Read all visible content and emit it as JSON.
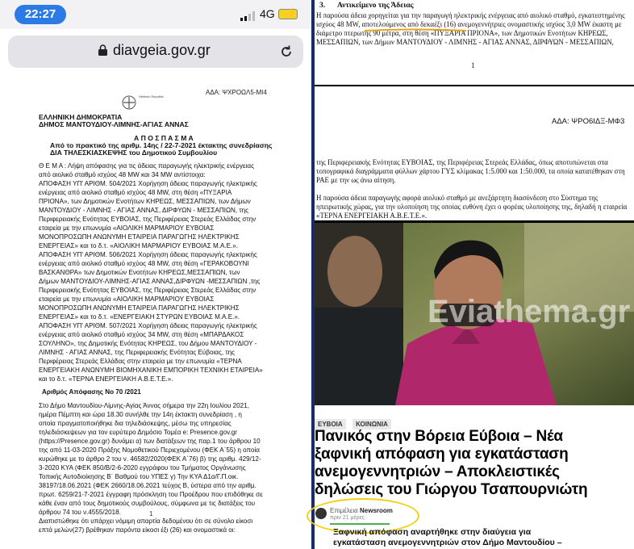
{
  "phone": {
    "status": {
      "time": "22:27",
      "network": "4G"
    },
    "browser": {
      "url": "diavgeia.gov.gr"
    },
    "document": {
      "ada": "ΑΔΑ: ΨΧΡΟΩΛ5-ΜΙ4",
      "logo_text": "Hellenic Republic",
      "lines": [
        {
          "t": "ΕΛΛΗΝΙΚΗ ΔΗΜΟΚΡΑΤΙΑ",
          "c": "bold"
        },
        {
          "t": "ΔΗΜΟΣ ΜΑΝΤΟΥΔΙΟΥ-ΛΙΜΝΗΣ-ΑΓΙΑΣ ΑΝΝΑΣ",
          "c": "bold"
        },
        {
          "t": "Α Π Ο Σ Π Α Σ Μ Α",
          "c": "bold"
        },
        {
          "t": "Από το πρακτικό της αριθμ. 14ης / 22-7-2021 έκτακτης συνεδρίασης",
          "c": "bold"
        },
        {
          "t": "ΔΙΑ ΤΗΛΕΣΚΙΑΣΚΕΨΗΣ του Δημοτικού Συμβουλίου",
          "c": "bold"
        },
        {
          "t": "Θ Ε Μ Α : Λήψη απόφασης για τις άδειας παραγωγής ηλεκτρικής ενέργειας",
          "c": ""
        },
        {
          "t": "από αιολικό σταθμό ισχύος 48 MW και 34 MW αντίστοιχα:",
          "c": ""
        },
        {
          "t": "ΑΠΟΦΑΣΗ ΥΠ' ΑΡΙΘΜ. 504/2021 Χορήγηση άδειας παραγωγής ηλεκτρικής",
          "c": ""
        },
        {
          "t": "ενέργειας από αιολικό σταθμό ισχύος 48 MW, στη θέση «ΠΥΞΑΡΙΑ",
          "c": ""
        },
        {
          "t": "ΠΡΙΟΝΑ», των Δημοτικών Ενοτήτων ΚΗΡΕΩΣ, ΜΕΣΣΑΠΙΩΝ, των Δήμων",
          "c": ""
        },
        {
          "t": "ΜΑΝΤΟΥΔΙΟΥ - ΛΙΜΝΗΣ - ΑΓΙΑΣ ΑΝΝΑΣ, ΔΙΡΦΥΩΝ - ΜΕΣΣΑΠΙΩΝ, της",
          "c": ""
        },
        {
          "t": "Περιφερειακής Ενότητας ΕΥΒΟΙΑΣ, της Περιφέρειας Στερεάς Ελλάδας στην",
          "c": ""
        },
        {
          "t": "εταιρεία με την επωνυμία «ΑΙΟΛΙΚΗ ΜΑΡΜΑΡΙΟΥ ΕΥΒΟΙΑΣ",
          "c": ""
        },
        {
          "t": "ΜΟΝΟΠΡΟΣΩΠΗ ΑΝΩΝΥΜΗ ΕΤΑΙΡΕΙΑ ΠΑΡΑΓΩΓΗΣ ΗΛΕΚΤΡΙΚΗΣ",
          "c": ""
        },
        {
          "t": "ΕΝΕΡΓΕΙΑΣ» και το δ.τ. «ΑΙΟΛΙΚΗ ΜΑΡΜΑΡΙΟΥ ΕΥΒΟΙΑΣ Μ.Α.Ε.».",
          "c": ""
        },
        {
          "t": "ΑΠΟΦΑΣΗ ΥΠ' ΑΡΙΘΜ. 506/2021 Χορήγηση άδειας παραγωγής ηλεκτρικής",
          "c": ""
        },
        {
          "t": "ενέργειας από αιολικό σταθμό ισχύος 48 MW, στη θέση «ΓΕΡΑΚΟΒΟΥΝΙ",
          "c": ""
        },
        {
          "t": "ΒΑΣΚΑΝΘΡΑ» των Δημοτικών Ενοτήτων ΚΗΡΕΩΣ,ΜΕΣΣΑΠΙΩΝ, των",
          "c": ""
        },
        {
          "t": "Δήμων ΜΑΝΤΟΥΔΙΟΥ-ΛΙΜΝΗΣ-ΑΓΙΑΣ ΑΝΝΑΣ,ΔΙΡΦΥΩΝ -ΜΕΣΣΑΠΙΩΝ ,της",
          "c": ""
        },
        {
          "t": "Περιφερειακής Ενότητας ΕΥΒΟΙΑΣ, της Περιφέρειας Στερεάς Ελλάδας στην",
          "c": ""
        },
        {
          "t": "εταιρεία με την επωνυμία «ΑΙΟΛΙΚΗ ΜΑΡΜΑΡΙΟΥ ΕΥΒΟΙΑΣ",
          "c": ""
        },
        {
          "t": "ΜΟΝΟΠΡΟΣΩΠΗ ΑΝΩΝΥΜΗ ΕΤΑΙΡΕΙΑ ΠΑΡΑΓΩΓΗΣ ΗΛΕΚΤΡΙΚΗΣ",
          "c": ""
        },
        {
          "t": "ΕΝΕΡΓΕΙΑΣ» και το δ.τ. «ΕΝΕΡΓΕΙΑΚΗ ΣΤΥΡΩΝ ΕΥΒΟΙΑΣ Μ.Α.Ε.».",
          "c": ""
        },
        {
          "t": "ΑΠΟΦΑΣΗ ΥΠ' ΑΡΙΘΜ. 507/2021 Χορήγηση άδειας παραγωγής ηλεκτρικής",
          "c": ""
        },
        {
          "t": "ενέργειας από αιολικό σταθμό ισχύος 34 MW, στη θέση «ΜΠΑΡΔΑΚΟΣ",
          "c": ""
        },
        {
          "t": "ΣΟΥΛΗΝΟ», της Δημοτικής Ενότητας ΚΗΡΕΩΣ, του Δήμου ΜΑΝΤΟΥΔΙΟΥ -",
          "c": ""
        },
        {
          "t": "ΛΙΜΝΗΣ - ΑΓΙΑΣ ΑΝΝΑΣ, της Περιφερειακής Ενότητας Εύβοιας, της",
          "c": ""
        },
        {
          "t": "Περιφέρειας Στερεάς Ελλάδας στην εταιρεία με την επωνυμία «ΤΕΡΝΑ",
          "c": ""
        },
        {
          "t": "ΕΝΕΡΓΕΙΑΚΗ ΑΝΩΝΥΜΗ ΒΙΟΜΗΧΑΝΙΚΗ ΕΜΠΟΡΙΚΗ ΤΕΧΝΙΚΗ ΕΤΑΙΡΕΙΑ»",
          "c": ""
        },
        {
          "t": "και το δ.τ. «ΤΕΡΝΑ ΕΝΕΡΓΕΙΑΚΗ Α.Β.Ε.Τ.Ε.».",
          "c": ""
        },
        {
          "t": "Αριθμός Απόφασης Νο 70 /2021",
          "c": "bold"
        },
        {
          "t": "Στο Δήμο Μαντουδίου-Λίμνης-Αγίας Άννας σήμερα την 22η Ιουλίου 2021,",
          "c": ""
        },
        {
          "t": "ημέρα Πέμπτη και ώρα 18.30 συνήλθε την 14η έκτακτη συνεδρίαση , η",
          "c": ""
        },
        {
          "t": "οποία πραγματοποιήθηκε δια τηλεδιάσκεψης, μέσω της υπηρεσίας",
          "c": ""
        },
        {
          "t": "τηλεδιάσκεψεων για τον ευρύτερο Δημόσιο Τομέα e: Presence.gov.gr",
          "c": ""
        },
        {
          "t": "(https://Presence.gov.gr) δυνάμει α) των διατάξεων της παρ.1 του άρθρου 10",
          "c": ""
        },
        {
          "t": "της από 11-03-2020 Πράξης Νομοθετικού Περιεχομένου (ΦΕΚ Α΄55) η οποία",
          "c": ""
        },
        {
          "t": "κυρώθηκε με το άρθρο 2 του ν. 46582/2020(ΦΕΚ Α΄76) β) της αριθμ. 429/12-",
          "c": ""
        },
        {
          "t": "3-2020 ΚΥΑ (ΦΕΚ 850/Β/2-6-2020 εγγράφου του Τμήματος Οργάνωσης",
          "c": ""
        },
        {
          "t": "Τοπικής Αυτοδιοίκησης Β΄ Βαθμού του ΥΠΕΣ γ) Την ΚΥΑ Δ1α/Γ.Π.οικ.",
          "c": ""
        },
        {
          "t": "38197/18.06.2021 (ΦΕΚ 2660/18.06.2021 τεύχος Β, ύστερα από την αριθμ.",
          "c": ""
        },
        {
          "t": "πρωτ. 6259/21-7-2021 έγγραφη πρόσκληση του Προέδρου που επιδόθηκε σε",
          "c": ""
        },
        {
          "t": "κάθε έναν από τους δημοτικούς συμβούλους, σύμφωνα με τις διατάξεις του",
          "c": ""
        },
        {
          "t": "άρθρου 74 του ν.4555/2018.",
          "c": ""
        },
        {
          "t": "Διαπιστώθηκε ότι υπάρχει νόμιμη απαρτία δεδομένου ότι σε σύνολο είκοσι",
          "c": ""
        },
        {
          "t": "επτά μελών(27) βρέθηκαν παρόντα είκοσι έξι (26) και ονομαστικά οι:",
          "c": ""
        }
      ],
      "page_number": "1"
    }
  },
  "right": {
    "panel1": {
      "heading_num": "3.",
      "heading": "Αντικείμενο της Άδειας",
      "lines": [
        "Η παρούσα άδεια χορηγείται για την παραγωγή ηλεκτρικής ενέργειας από αιολικό σταθμό, εγκατεστημένης",
        "ισχύος 48 MW, αποτελούμενος από δεκαέξι (16) ανεμογεννήτριες ονομαστικής ισχύος 3,0 MW έκαστη με",
        "διάμετρο πτερωτής 90 μέτρα, στη θέση «ΠΥΞΑΡΙΑ ΠΡΙΟΝΑ», των Δημοτικών Ενοτήτων ΚΗΡΕΩΣ,",
        "ΜΕΣΣΑΠΙΩΝ, των Δήμων ΜΑΝΤΟΥΔΙΟΥ - ΛΙΜΝΗΣ - ΑΓΙΑΣ ΑΝΝΑΣ, ΔΙΡΦΥΩΝ - ΜΕΣΣΑΠΙΩΝ,"
      ],
      "page_number": "1"
    },
    "panel2": {
      "ada": "ΑΔΑ: ΨΡΟ6ΙΔΞ-ΜΦ3",
      "lines": [
        "της Περιφερειακής Ενότητας ΕΥΒΟΙΑΣ, της Περιφέρειας Στερεάς Ελλάδας, όπως αποτυπώνεται στα",
        "τοπογραφικά διαγράμματα φύλλων χάρτου ΓΥΣ κλίμακας 1:5.000 και 1:50.000, τα οποία κατατέθηκαν στη",
        "ΡΑΕ με την ως άνω αίτηση.",
        "",
        "Η παρούσα άδεια παραγωγής αφορά αιολικό σταθμό με ανεξάρτητη διασύνδεση στο Σύστημα της",
        "ηπειρωτικής χώρας, για την υλοποίηση της οποίας ευθύνη έχει ο φορέας υλοποίησης της, δηλαδή η εταιρεία",
        "«ΤΕΡΝΑ ΕΝΕΡΓΕΙΑΚΗ Α.Β.Ε.Τ.Ε.»."
      ]
    },
    "article": {
      "watermark": "Eviathema.gr",
      "tags": [
        "ΕΥΒΟΙΑ",
        "ΚΟΙΝΩΝΙΑ"
      ],
      "headline": [
        "Πανικός στην Βόρεια Εύβοια – Νέα",
        "ξαφνική απόφαση για εγκατάσταση",
        "ανεμογεννητριών – Αποκλειστικές",
        "δηλώσεις του Γιώργου Τσαπουρνιώτη"
      ],
      "byline_prefix": "Επιμέλεια",
      "byline_author": "Newsroom",
      "byline_time": "πριν 21 μέρες",
      "lead": [
        "Ξαφνική απόφαση αναρτήθηκε στην διαύγεια για",
        "εγκατάσταση ανεμογεννητριών στον Δήμο Μαντουδίου –"
      ]
    }
  },
  "colors": {
    "time_pill": "#2c7be5",
    "divider": "#1a2a6c",
    "highlight_circle": "#f1d116",
    "underline_mark": "#e8a317",
    "shirt": "#b0276b"
  }
}
